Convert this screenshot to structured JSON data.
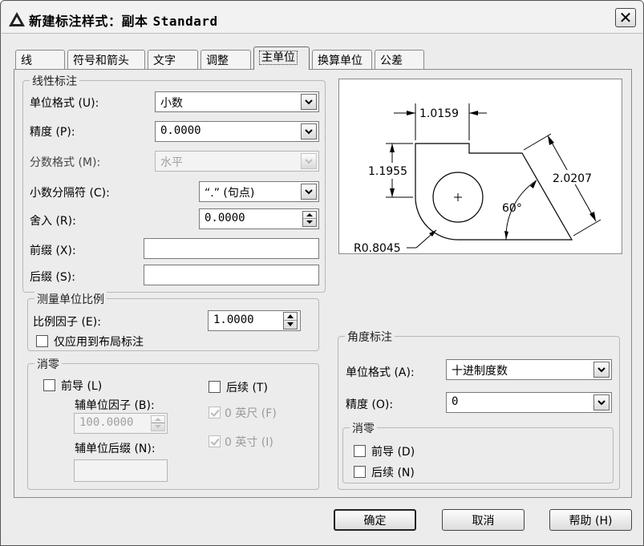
{
  "window": {
    "title_cn": "新建标注样式：副本",
    "title_style": "Standard"
  },
  "tabs": [
    {
      "label": "线"
    },
    {
      "label": "符号和箭头"
    },
    {
      "label": "文字"
    },
    {
      "label": "调整"
    },
    {
      "label": "主单位",
      "active": true
    },
    {
      "label": "换算单位"
    },
    {
      "label": "公差"
    }
  ],
  "linear": {
    "legend": "线性标注",
    "unit_format_label": "单位格式 (U):",
    "unit_format_value": "小数",
    "precision_label": "精度 (P):",
    "precision_value": "0.0000",
    "fraction_format_label": "分数格式 (M):",
    "fraction_format_value": "水平",
    "decimal_sep_label": "小数分隔符 (C):",
    "decimal_sep_value": "“.”  (句点)",
    "round_label": "舍入 (R):",
    "round_value": "0.0000",
    "prefix_label": "前缀 (X):",
    "prefix_value": "",
    "suffix_label": "后缀 (S):",
    "suffix_value": ""
  },
  "scale": {
    "legend": "测量单位比例",
    "factor_label": "比例因子 (E):",
    "factor_value": "1.0000",
    "layout_only_label": "仅应用到布局标注",
    "layout_only_checked": false
  },
  "zero_linear": {
    "legend": "消零",
    "leading_label": "前导 (L)",
    "leading_checked": false,
    "trailing_label": "后续 (T)",
    "trailing_checked": false,
    "sub_factor_label": "辅单位因子 (B):",
    "sub_factor_value": "100.0000",
    "sub_suffix_label": "辅单位后缀 (N):",
    "sub_suffix_value": "",
    "feet_label": "0 英尺 (F)",
    "inch_label": "0 英寸 (I)"
  },
  "angular": {
    "legend": "角度标注",
    "unit_format_label": "单位格式 (A):",
    "unit_format_value": "十进制度数",
    "precision_label": "精度 (O):",
    "precision_value": "0",
    "zero_legend": "消零",
    "leading_label": "前导 (D)",
    "leading_checked": false,
    "trailing_label": "后续 (N)",
    "trailing_checked": false
  },
  "preview": {
    "dim_top": "1.0159",
    "dim_left": "1.1955",
    "dim_right": "2.0207",
    "dim_angle": "60°",
    "dim_radius": "R0.8045"
  },
  "buttons": {
    "ok": "确定",
    "cancel": "取消",
    "help": "帮助 (H)"
  }
}
